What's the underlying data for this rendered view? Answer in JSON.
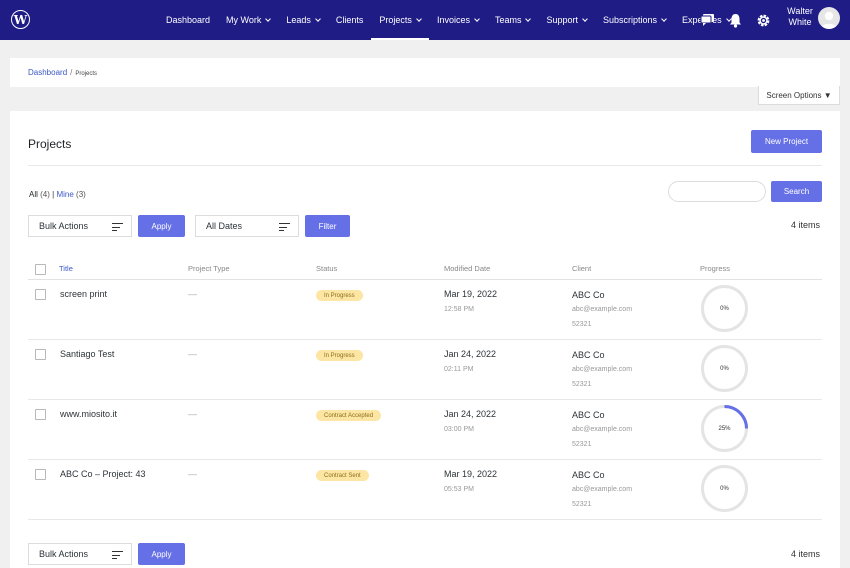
{
  "nav": {
    "items": [
      {
        "label": "Dashboard",
        "dropdown": false,
        "active": false
      },
      {
        "label": "My Work",
        "dropdown": true,
        "active": false
      },
      {
        "label": "Leads",
        "dropdown": true,
        "active": false
      },
      {
        "label": "Clients",
        "dropdown": false,
        "active": false
      },
      {
        "label": "Projects",
        "dropdown": true,
        "active": true
      },
      {
        "label": "Invoices",
        "dropdown": true,
        "active": false
      },
      {
        "label": "Teams",
        "dropdown": true,
        "active": false
      },
      {
        "label": "Support",
        "dropdown": true,
        "active": false
      },
      {
        "label": "Subscriptions",
        "dropdown": true,
        "active": false
      },
      {
        "label": "Expenses",
        "dropdown": true,
        "active": false
      }
    ],
    "user_first": "Walter",
    "user_last": "White",
    "icons": [
      "wordpress-logo-icon",
      "messages-icon",
      "bell-icon",
      "gear-icon"
    ]
  },
  "breadcrumb": {
    "root": "Dashboard",
    "current": "Projects"
  },
  "screen_options": "Screen Options ▼",
  "page": {
    "title": "Projects",
    "new_button": "New Project",
    "filter_all": "All",
    "filter_all_count": "(4)",
    "filter_mine": "Mine",
    "filter_mine_count": "(3)",
    "search_button": "Search",
    "bulk_actions": "Bulk Actions",
    "apply": "Apply",
    "all_dates": "All Dates",
    "filter": "Filter",
    "item_count": "4 items"
  },
  "table": {
    "columns": [
      "Title",
      "Project Type",
      "Status",
      "Modified Date",
      "Client",
      "Progress"
    ],
    "rows": [
      {
        "name": "screen print",
        "type": "—",
        "status": "In Progress",
        "date": "Mar 19, 2022",
        "time": "12:58 PM",
        "client": "ABC Co",
        "email": "abc@example.com",
        "zip": "52321",
        "progress": 0,
        "progress_label": "0%"
      },
      {
        "name": "Santiago Test",
        "type": "—",
        "status": "In Progress",
        "date": "Jan 24, 2022",
        "time": "02:11 PM",
        "client": "ABC Co",
        "email": "abc@example.com",
        "zip": "52321",
        "progress": 0,
        "progress_label": "0%"
      },
      {
        "name": "www.miosito.it",
        "type": "—",
        "status": "Contract Accepted",
        "date": "Jan 24, 2022",
        "time": "03:00 PM",
        "client": "ABC Co",
        "email": "abc@example.com",
        "zip": "52321",
        "progress": 0.25,
        "progress_label": "25%"
      },
      {
        "name": "ABC Co – Project: 43",
        "type": "—",
        "status": "Contract Sent",
        "date": "Mar 19, 2022",
        "time": "05:53 PM",
        "client": "ABC Co",
        "email": "abc@example.com",
        "zip": "52321",
        "progress": 0,
        "progress_label": "0%"
      }
    ]
  },
  "colors": {
    "nav_bg": "#1f1c86",
    "accent": "#6670e6",
    "badge_bg": "#fde6a3",
    "ring_track": "#e4e4e4",
    "ring_fill": "#6670e6"
  }
}
